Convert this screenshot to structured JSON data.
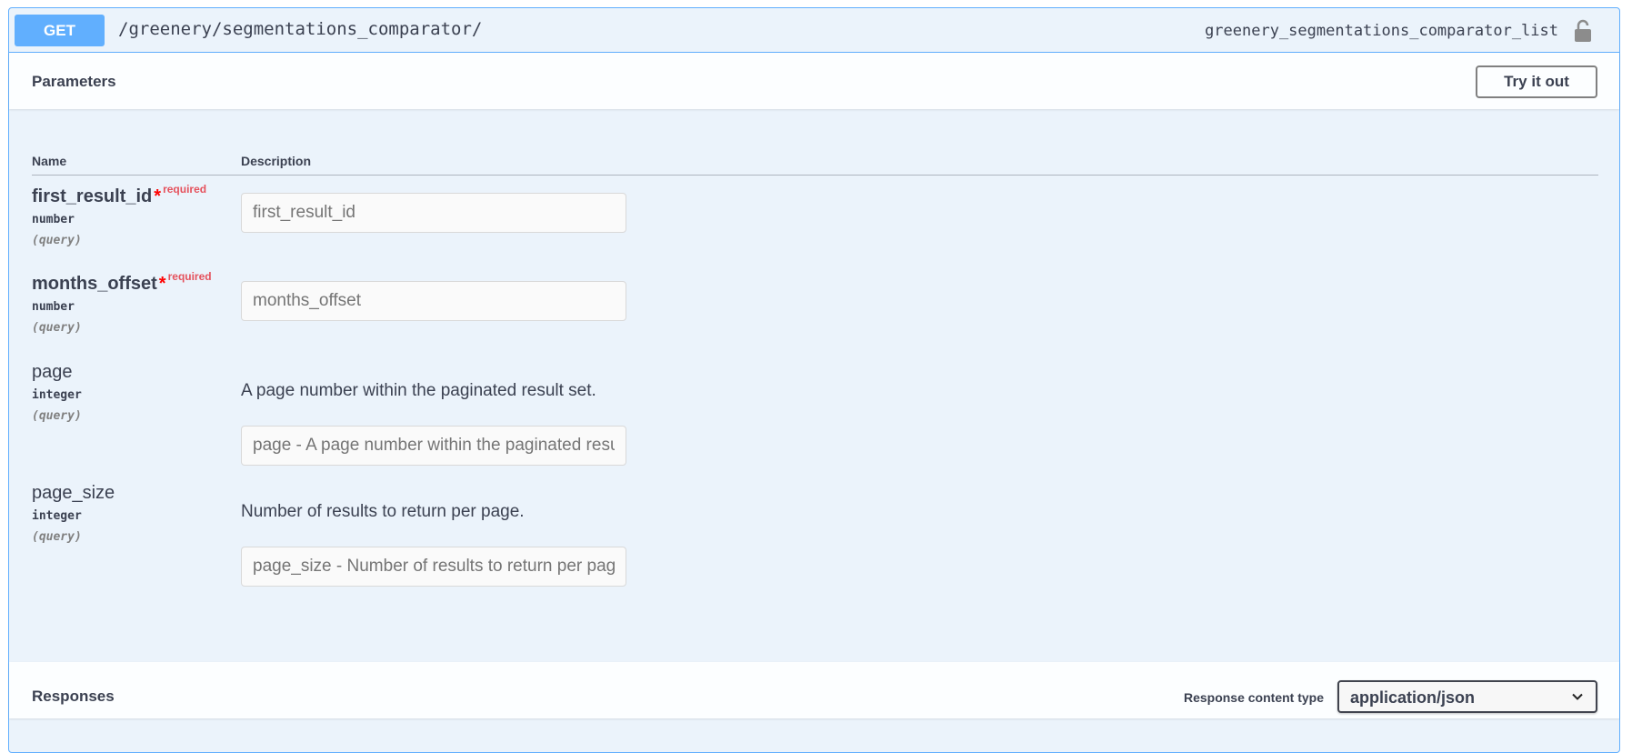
{
  "summary": {
    "method": "GET",
    "path": "/greenery/segmentations_comparator/",
    "operation_id": "greenery_segmentations_comparator_list",
    "lock_icon": "unlock-icon"
  },
  "parameters": {
    "title": "Parameters",
    "try_button": "Try it out",
    "col_name": "Name",
    "col_description": "Description",
    "required_label": "required",
    "required_star": "*",
    "items": [
      {
        "name": "first_result_id",
        "type": "number",
        "in": "(query)",
        "required": true,
        "description": "",
        "placeholder": "first_result_id"
      },
      {
        "name": "months_offset",
        "type": "number",
        "in": "(query)",
        "required": true,
        "description": "",
        "placeholder": "months_offset"
      },
      {
        "name": "page",
        "type": "integer",
        "in": "(query)",
        "required": false,
        "description": "A page number within the paginated result set.",
        "placeholder": "page - A page number within the paginated result set."
      },
      {
        "name": "page_size",
        "type": "integer",
        "in": "(query)",
        "required": false,
        "description": "Number of results to return per page.",
        "placeholder": "page_size - Number of results to return per page."
      }
    ]
  },
  "responses": {
    "title": "Responses",
    "content_type_label": "Response content type",
    "content_type_value": "application/json",
    "chevron_icon": "chevron-down-icon"
  },
  "colors": {
    "get_method": "#61affe",
    "block_background": "#ebf3fb",
    "required": "#e5525d"
  }
}
